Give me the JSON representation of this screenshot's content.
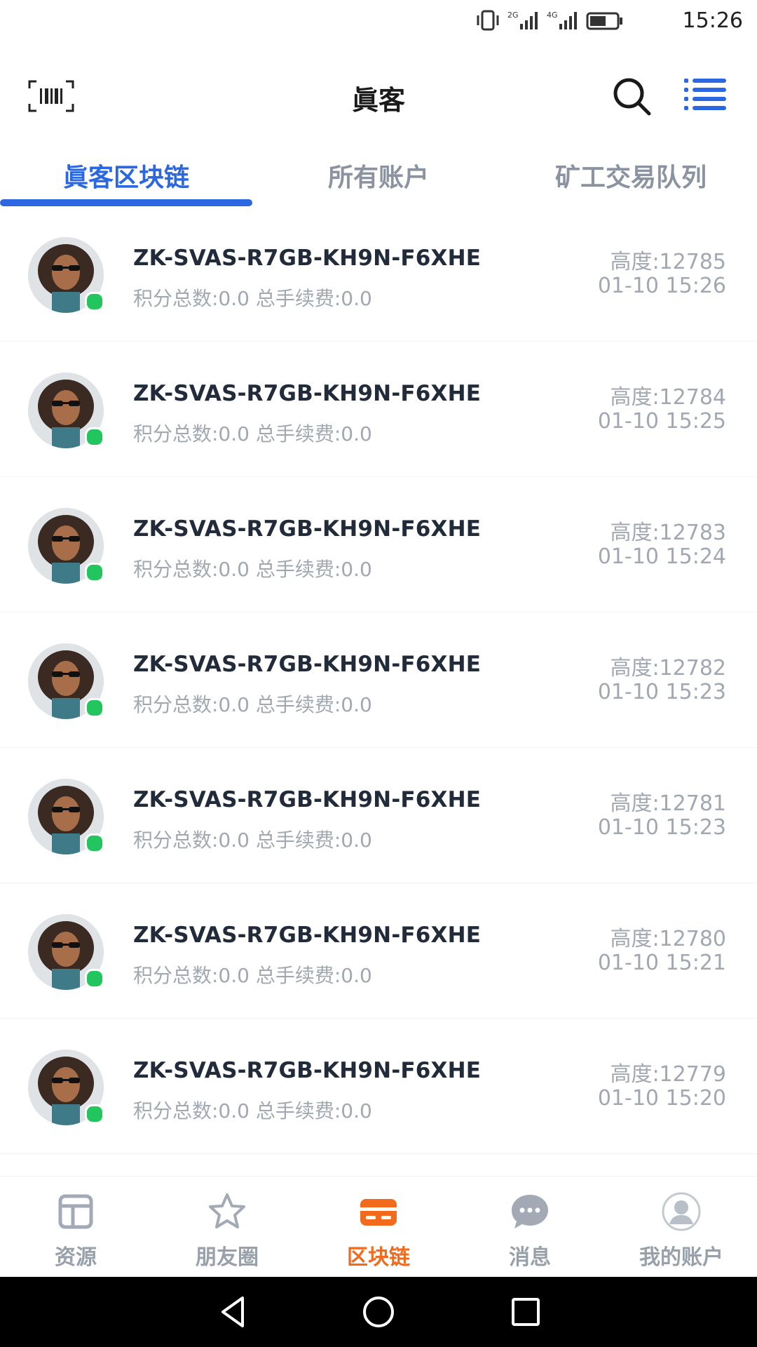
{
  "status_bar": {
    "time": "15:26",
    "net1": "2G",
    "net2": "4G"
  },
  "app_bar": {
    "title": "眞客"
  },
  "tabs": [
    {
      "label": "眞客区块链",
      "active": true
    },
    {
      "label": "所有账户",
      "active": false
    },
    {
      "label": "矿工交易队列",
      "active": false
    }
  ],
  "blocks": [
    {
      "account": "ZK-SVAS-R7GB-KH9N-F6XHE",
      "summary": "积分总数:0.0 总手续费:0.0",
      "height": "高度:12785",
      "time": "01-10 15:26"
    },
    {
      "account": "ZK-SVAS-R7GB-KH9N-F6XHE",
      "summary": "积分总数:0.0 总手续费:0.0",
      "height": "高度:12784",
      "time": "01-10 15:25"
    },
    {
      "account": "ZK-SVAS-R7GB-KH9N-F6XHE",
      "summary": "积分总数:0.0 总手续费:0.0",
      "height": "高度:12783",
      "time": "01-10 15:24"
    },
    {
      "account": "ZK-SVAS-R7GB-KH9N-F6XHE",
      "summary": "积分总数:0.0 总手续费:0.0",
      "height": "高度:12782",
      "time": "01-10 15:23"
    },
    {
      "account": "ZK-SVAS-R7GB-KH9N-F6XHE",
      "summary": "积分总数:0.0 总手续费:0.0",
      "height": "高度:12781",
      "time": "01-10 15:23"
    },
    {
      "account": "ZK-SVAS-R7GB-KH9N-F6XHE",
      "summary": "积分总数:0.0 总手续费:0.0",
      "height": "高度:12780",
      "time": "01-10 15:21"
    },
    {
      "account": "ZK-SVAS-R7GB-KH9N-F6XHE",
      "summary": "积分总数:0.0 总手续费:0.0",
      "height": "高度:12779",
      "time": "01-10 15:20"
    }
  ],
  "bottom_nav": [
    {
      "label": "资源",
      "icon": "layout-icon",
      "active": false
    },
    {
      "label": "朋友圈",
      "icon": "star-icon",
      "active": false
    },
    {
      "label": "区块链",
      "icon": "card-icon",
      "active": true
    },
    {
      "label": "消息",
      "icon": "chat-icon",
      "active": false
    },
    {
      "label": "我的账户",
      "icon": "user-icon",
      "active": false
    }
  ],
  "colors": {
    "accent": "#2a67e0",
    "active_nav": "#f26a1b",
    "online": "#22c55e",
    "muted": "#a2a8b2"
  }
}
